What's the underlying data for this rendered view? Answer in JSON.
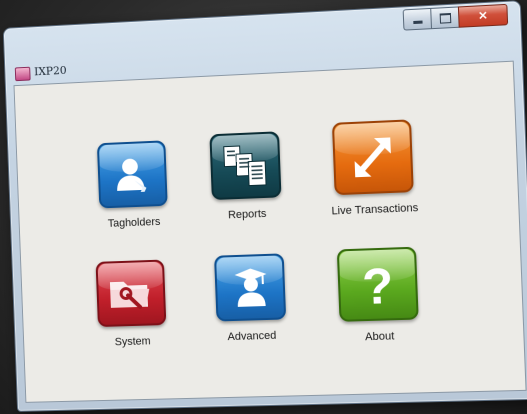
{
  "window": {
    "title": "IXP20",
    "buttons": {
      "minimize": "minimize",
      "maximize": "maximize",
      "close": "✕"
    }
  },
  "tiles": [
    {
      "label": "Tagholders",
      "icon": "user-icon",
      "color": "#1d74c6"
    },
    {
      "label": "Reports",
      "icon": "documents-icon",
      "color": "#164a56"
    },
    {
      "label": "Live Transactions",
      "icon": "double-arrow-icon",
      "color": "#e56b0f"
    },
    {
      "label": "System",
      "icon": "folder-wrench-icon",
      "color": "#c01f2a"
    },
    {
      "label": "Advanced",
      "icon": "graduate-user-icon",
      "color": "#1d74c6"
    },
    {
      "label": "About",
      "icon": "question-mark-icon",
      "color": "#5aa81e"
    }
  ]
}
